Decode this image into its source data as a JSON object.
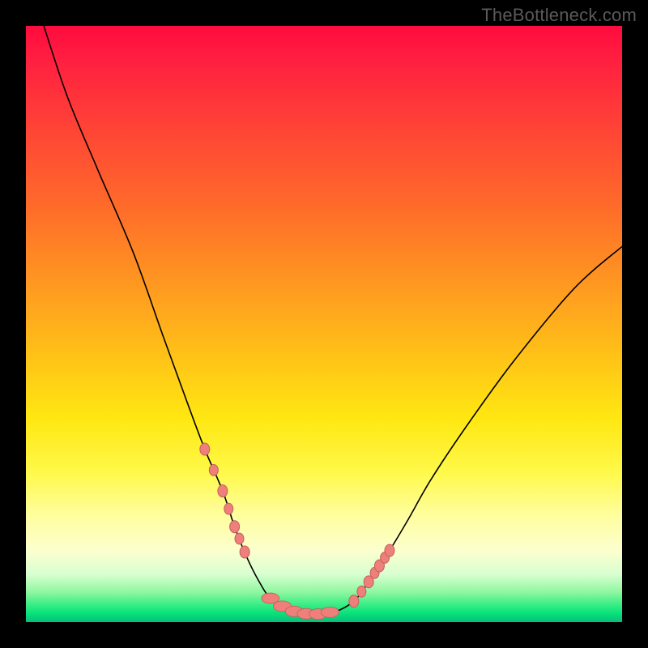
{
  "watermark": "TheBottleneck.com",
  "chart_data": {
    "type": "line",
    "title": "",
    "xlabel": "",
    "ylabel": "",
    "xlim": [
      0,
      100
    ],
    "ylim": [
      0,
      100
    ],
    "legend": false,
    "description": "Single V-shaped curve over a vertical rainbow heat gradient (red top → green bottom). Left branch descends steeply from near top-left to a flat minimum around x≈40–52, right branch rises more gently toward the upper right. Salmon-colored bead markers cluster on both branches near the valley floor.",
    "series": [
      {
        "name": "bottleneck-curve",
        "x": [
          3,
          7,
          12,
          18,
          23,
          27,
          30,
          33,
          35,
          37,
          39,
          41,
          44,
          48,
          52,
          55,
          57,
          59,
          61,
          64,
          68,
          74,
          82,
          92,
          100
        ],
        "y": [
          100,
          88,
          76,
          62,
          48,
          37,
          29,
          22,
          16,
          11,
          7,
          4,
          2,
          1.2,
          1.8,
          3.5,
          6,
          9,
          12,
          17,
          24,
          33,
          44,
          56,
          63
        ]
      }
    ],
    "markers_on_curve": {
      "left_cluster_x": [
        30,
        31.5,
        33,
        34,
        35,
        35.8,
        36.7
      ],
      "valley_blob_x": [
        41,
        43,
        45,
        47,
        49,
        51
      ],
      "right_cluster_x": [
        55,
        56.3,
        57.5,
        58.5,
        59.3,
        60.2,
        61
      ]
    },
    "marker_style": {
      "color": "#ee7f7a",
      "outline": "#c2605c",
      "radius_px": 6
    },
    "background_gradient": {
      "stops": [
        {
          "pos": 0.0,
          "color": "#ff0b3e"
        },
        {
          "pos": 0.3,
          "color": "#ff6a2a"
        },
        {
          "pos": 0.56,
          "color": "#ffc417"
        },
        {
          "pos": 0.75,
          "color": "#fff94b"
        },
        {
          "pos": 0.92,
          "color": "#d8ffd0"
        },
        {
          "pos": 1.0,
          "color": "#07be7a"
        }
      ]
    }
  }
}
